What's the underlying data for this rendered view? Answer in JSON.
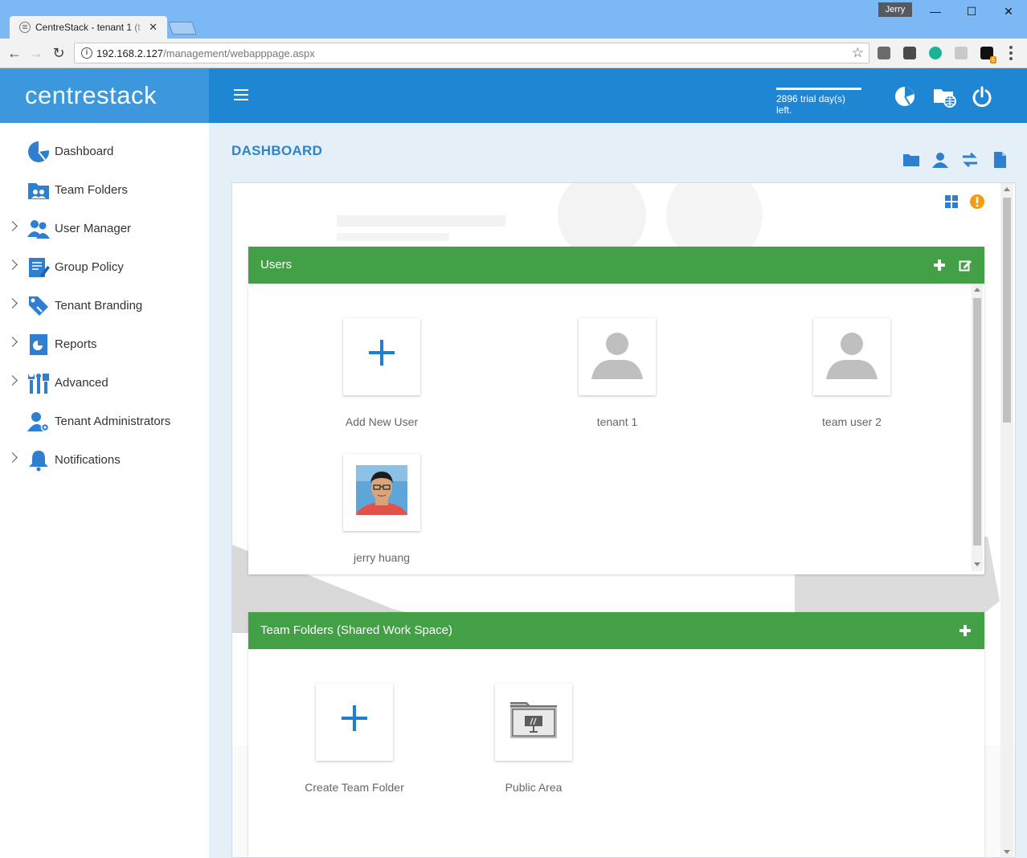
{
  "browser": {
    "tab_title": "CentreStack - tenant 1 (t",
    "tab_close": "✕",
    "profile_name": "Jerry",
    "url_host": "192.168.2.127",
    "url_path": "/management/webapppage.aspx",
    "extension_badge": "6"
  },
  "header": {
    "brand_light": "centre",
    "brand_bold": "stack",
    "trial_text": "2896 trial day(s) left.",
    "trial_progress_percent": 100
  },
  "sidebar": {
    "items": [
      {
        "label": "Dashboard",
        "icon": "dashboard-icon",
        "expandable": false
      },
      {
        "label": "Team Folders",
        "icon": "team-folders-icon",
        "expandable": false
      },
      {
        "label": "User Manager",
        "icon": "users-icon",
        "expandable": true
      },
      {
        "label": "Group Policy",
        "icon": "policy-icon",
        "expandable": true
      },
      {
        "label": "Tenant Branding",
        "icon": "branding-icon",
        "expandable": true
      },
      {
        "label": "Reports",
        "icon": "reports-icon",
        "expandable": true
      },
      {
        "label": "Advanced",
        "icon": "tools-icon",
        "expandable": true
      },
      {
        "label": "Tenant Administrators",
        "icon": "admin-icon",
        "expandable": false
      },
      {
        "label": "Notifications",
        "icon": "bell-icon",
        "expandable": true
      }
    ]
  },
  "main": {
    "title": "DASHBOARD",
    "users_card": {
      "title": "Users",
      "tiles": [
        {
          "label": "Add New User",
          "kind": "add"
        },
        {
          "label": "tenant 1",
          "kind": "avatar"
        },
        {
          "label": "team user 2",
          "kind": "avatar"
        },
        {
          "label": "jerry huang",
          "kind": "photo"
        }
      ]
    },
    "team_folders_card": {
      "title": "Team Folders (Shared Work Space)",
      "tiles": [
        {
          "label": "Create Team Folder",
          "kind": "add"
        },
        {
          "label": "Public Area",
          "kind": "folder"
        }
      ]
    }
  },
  "colors": {
    "header_blue": "#1f86d3",
    "brand_blue": "#3d97dc",
    "card_green": "#43a047",
    "title_blue": "#2d84c9",
    "accent_orange": "#f39c12"
  }
}
